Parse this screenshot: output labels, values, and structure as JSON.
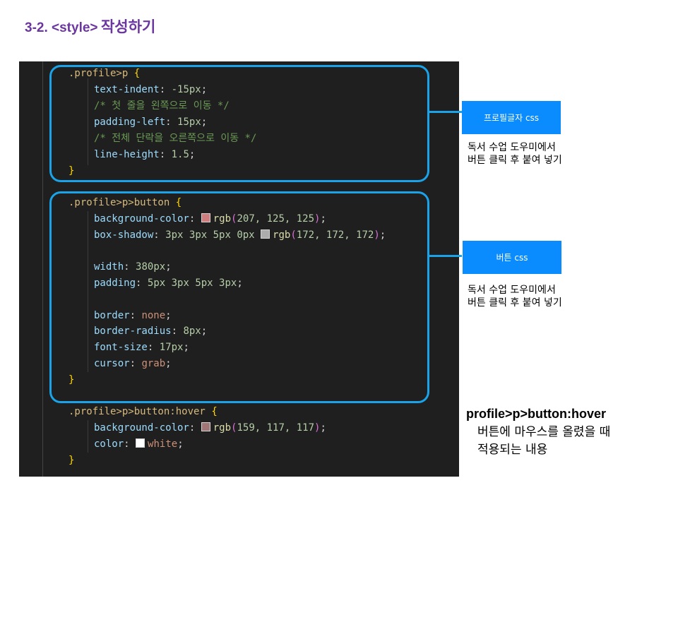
{
  "title": {
    "prefix": "3-2. <style>",
    "suffix": "작성하기"
  },
  "code": {
    "block1": {
      "line1_selector": ".profile>p",
      "line2_prop": "text-indent",
      "line2_value": "-15px",
      "line3_comment": "/* 첫 줄을 왼쪽으로 이동 */",
      "line4_prop": "padding-left",
      "line4_value": "15px",
      "line5_comment": "/* 전체 단락을 오른쪽으로 이동 */",
      "line6_prop": "line-height",
      "line6_value": "1.5"
    },
    "block2": {
      "selector": ".profile>p>button",
      "bg_prop": "background-color",
      "bg_fn": "rgb",
      "bg_args": "207, 125, 125",
      "shadow_prop": "box-shadow",
      "shadow_values": "3px 3px 5px 0px",
      "shadow_fn": "rgb",
      "shadow_args": "172, 172, 172",
      "width_prop": "width",
      "width_value": "380px",
      "padding_prop": "padding",
      "padding_value": "5px 3px 5px 3px",
      "border_prop": "border",
      "border_value": "none",
      "radius_prop": "border-radius",
      "radius_value": "8px",
      "font_prop": "font-size",
      "font_value": "17px",
      "cursor_prop": "cursor",
      "cursor_value": "grab"
    },
    "block3": {
      "selector": ".profile>p>button:hover",
      "bg_prop": "background-color",
      "bg_fn": "rgb",
      "bg_args": "159, 117, 117",
      "color_prop": "color",
      "color_value": "white"
    },
    "open_brace": "{",
    "close_brace": "}",
    "colon": ":",
    "semicolon": ";",
    "lparen": "(",
    "rparen": ")"
  },
  "swatch_colors": {
    "bg1": "#cf7d7d",
    "shadow": "#acacac",
    "bg3": "#9f7575",
    "white": "#ffffff"
  },
  "annotations": {
    "profile_tag": "프로필글자 css",
    "profile_note_line1": "독서 수업 도우미에서",
    "profile_note_line2": "버튼 클릭 후 붙여 넣기",
    "button_tag": "버튼 css",
    "button_note_line1": "독서 수업 도우미에서",
    "button_note_line2": "버튼 클릭 후 붙여 넣기",
    "hover_title": "profile>p>button:hover",
    "hover_desc_line1": "버튼에 마우스를 올렸을 때",
    "hover_desc_line2": "적용되는 내용"
  },
  "colors": {
    "title": "#6b36a0",
    "highlight_border": "#1aa3e8",
    "tag_bg": "#0a8cff",
    "editor_bg": "#1f1f1f"
  }
}
